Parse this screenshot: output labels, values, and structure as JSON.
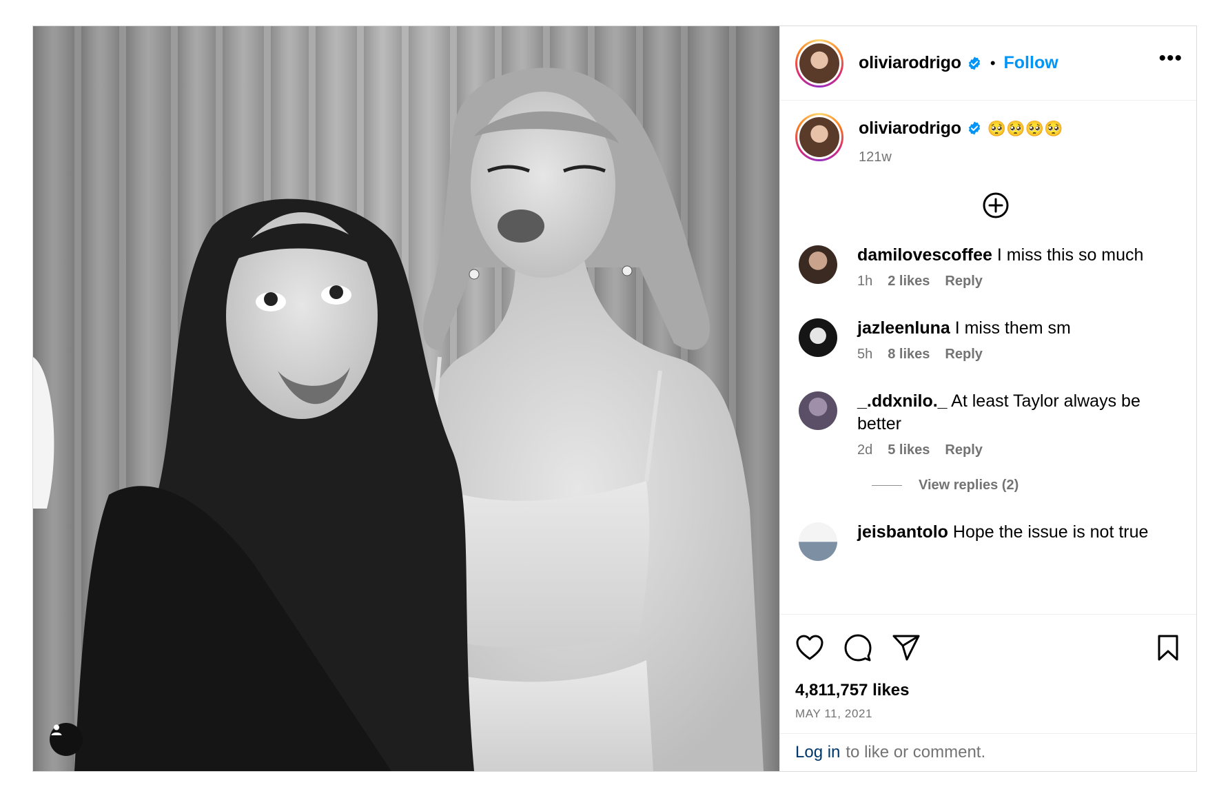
{
  "post": {
    "username": "oliviarodrigo",
    "follow_label": "Follow",
    "separator": "•",
    "more_label": "•••"
  },
  "caption": {
    "username": "oliviarodrigo",
    "text": "🥺🥺🥺🥺",
    "time": "121w"
  },
  "comments": [
    {
      "username": "damilovescoffee",
      "text": "I miss this so much",
      "time": "1h",
      "likes": "2 likes",
      "reply": "Reply"
    },
    {
      "username": "jazleenluna",
      "text": "I miss them sm",
      "time": "5h",
      "likes": "8 likes",
      "reply": "Reply"
    },
    {
      "username": "_.ddxnilo._",
      "text": "At least Taylor always be better",
      "time": "2d",
      "likes": "5 likes",
      "reply": "Reply",
      "view_replies": "View replies (2)"
    },
    {
      "username": "jeisbantolo",
      "text": "Hope the issue is not true"
    }
  ],
  "footer": {
    "likes": "4,811,757 likes",
    "date": "MAY 11, 2021",
    "login_link": "Log in",
    "login_suffix": "to like or comment."
  },
  "colors": {
    "accent": "#0095f6",
    "verified": "#0095f6",
    "muted": "#737373",
    "link_dark": "#00376b"
  },
  "icons": [
    "user-tag-icon",
    "verified-badge-icon",
    "more-options-icon",
    "add-circle-icon",
    "heart-icon",
    "comment-icon",
    "share-icon",
    "bookmark-icon"
  ]
}
